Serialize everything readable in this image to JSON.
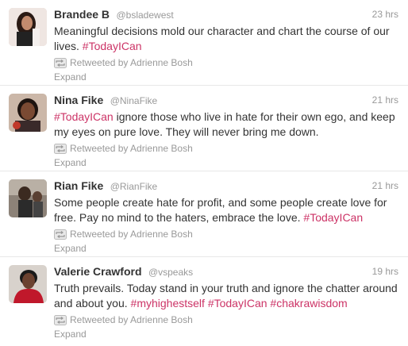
{
  "tweets": [
    {
      "fullname": "Brandee B",
      "username": "@bsladewest",
      "time": "23 hrs",
      "text_plain": "Meaningful decisions mold our character and chart the course of our lives. ",
      "hashtags": "#TodayICan",
      "text_after": "",
      "retweeted_by": "Retweeted by Adrienne Bosh",
      "expand": "Expand"
    },
    {
      "fullname": "Nina Fike",
      "username": "@NinaFike",
      "time": "21 hrs",
      "hashtags_lead": "#TodayICan",
      "text_plain": " ignore those who live in hate for their own ego, and keep my eyes on pure love. They will never bring me down.",
      "retweeted_by": "Retweeted by Adrienne Bosh",
      "expand": "Expand"
    },
    {
      "fullname": "Rian Fike",
      "username": "@RianFike",
      "time": "21 hrs",
      "text_plain": "Some people create hate for profit, and some people create love for free. Pay no mind to the haters, embrace the love. ",
      "hashtags": "#TodayICan",
      "retweeted_by": "Retweeted by Adrienne Bosh",
      "expand": "Expand"
    },
    {
      "fullname": "Valerie Crawford",
      "username": "@vspeaks",
      "time": "19 hrs",
      "text_plain": "Truth prevails. Today stand in your truth and ignore the chatter around and about you. ",
      "hashtag_1": "#myhighestself",
      "hashtag_2": "#TodayICan",
      "hashtag_3": "#chakrawisdom",
      "retweeted_by": "Retweeted by Adrienne Bosh",
      "expand": "Expand"
    }
  ],
  "colors": {
    "hashtag": "#cc3366",
    "meta_gray": "#999999",
    "text": "#333333",
    "divider": "#e8e8e8"
  },
  "icons": {
    "retweet": "retweet-icon"
  }
}
